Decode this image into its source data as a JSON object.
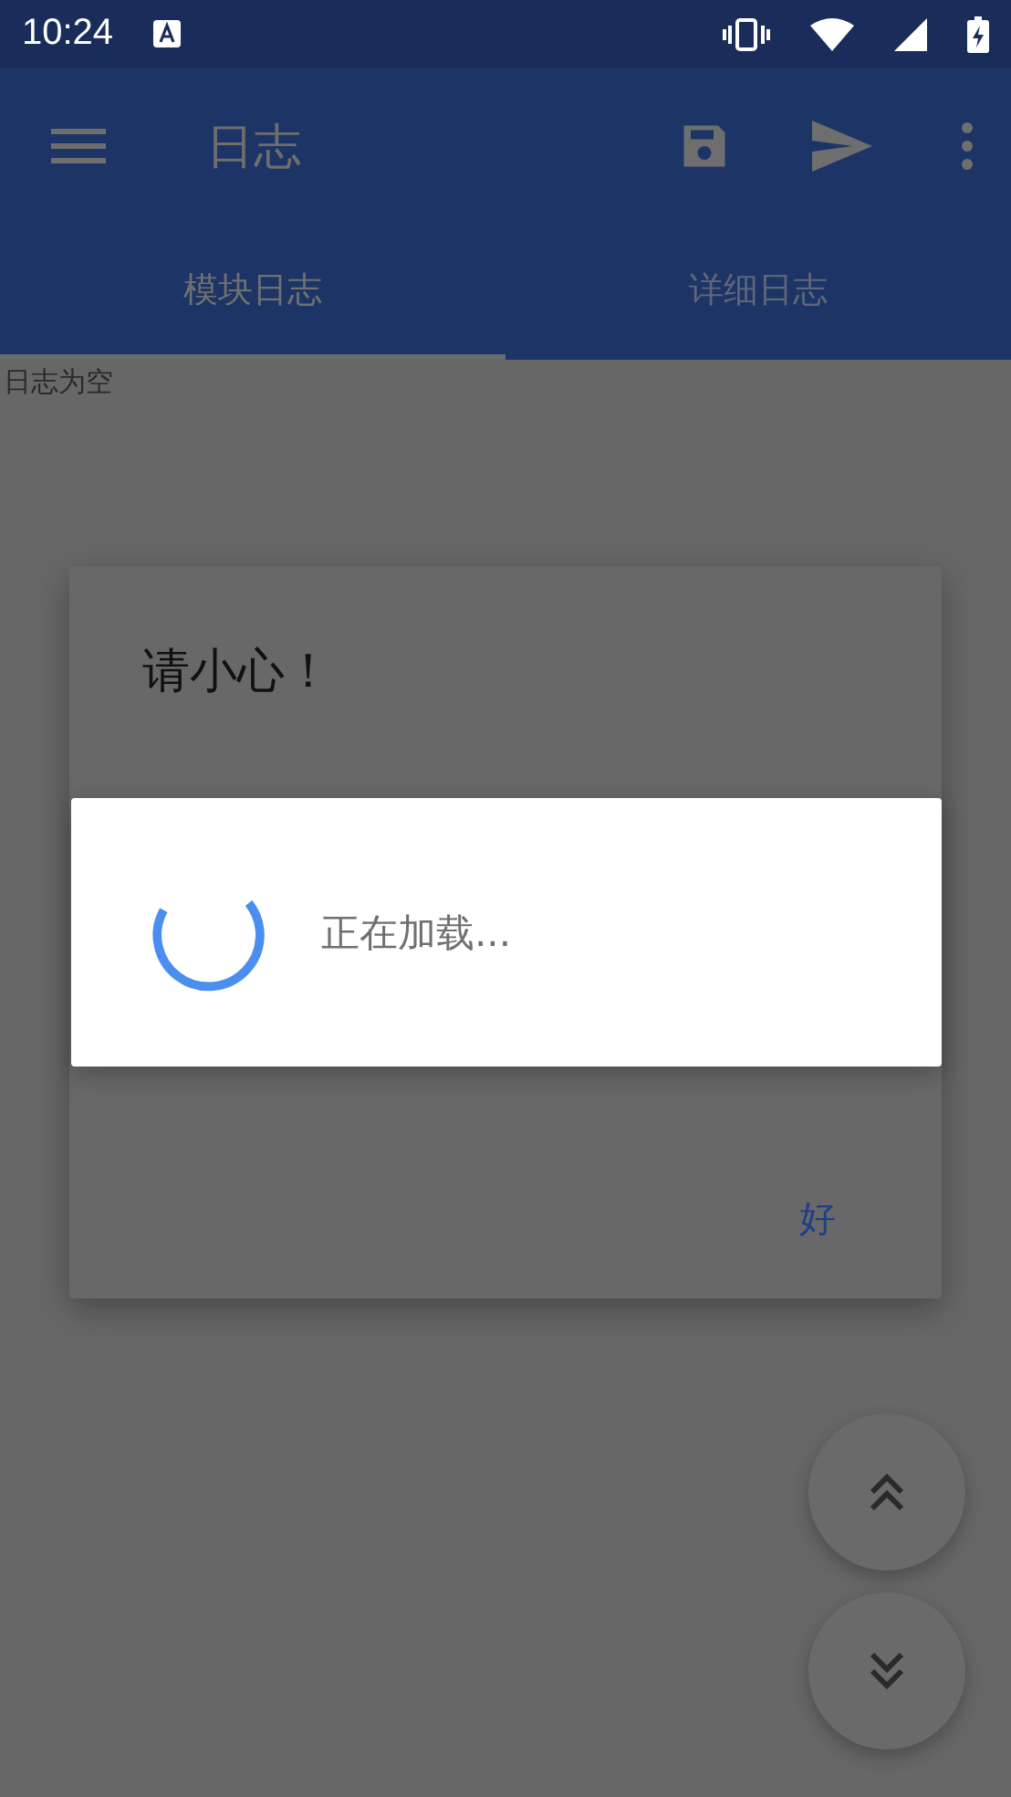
{
  "status_bar": {
    "time": "10:24"
  },
  "app_bar": {
    "title": "日志"
  },
  "tabs": [
    {
      "label": "模块日志",
      "selected": true
    },
    {
      "label": "详细日志",
      "selected": false
    }
  ],
  "log": {
    "empty_text": "日志为空"
  },
  "alert_dialog": {
    "title": "请小心！",
    "button": "好"
  },
  "loading_dialog": {
    "text": "正在加载..."
  }
}
